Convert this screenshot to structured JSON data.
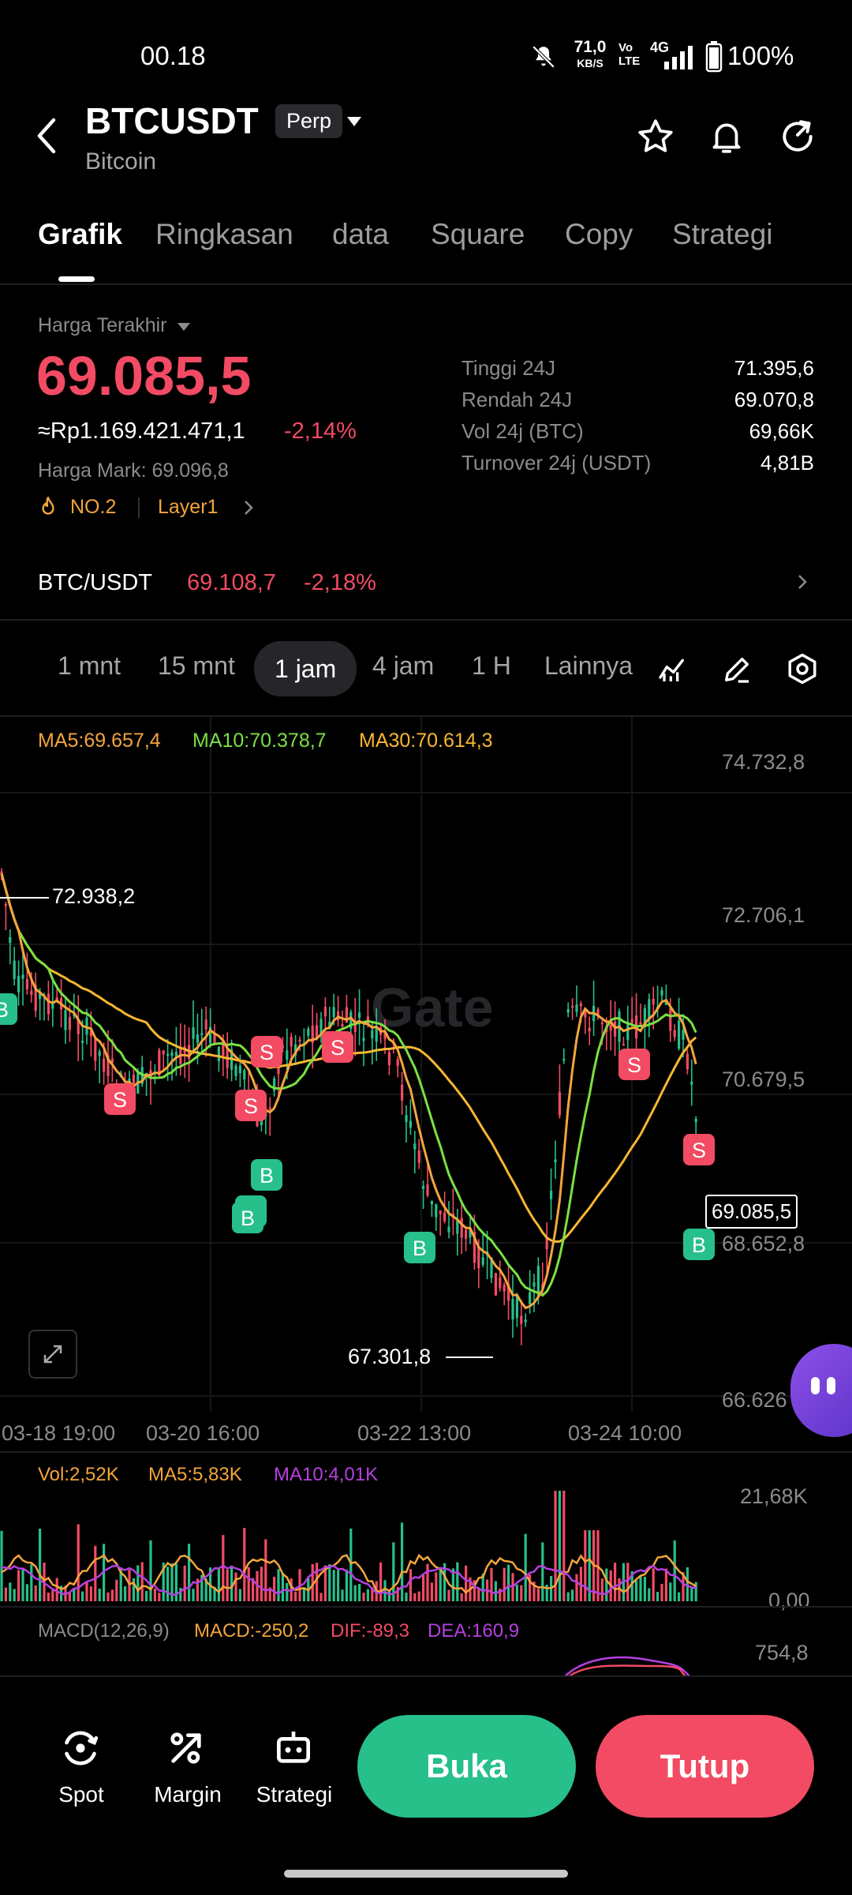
{
  "status_bar": {
    "time": "00.18",
    "net_speed": "71,0",
    "net_unit": "KB/S",
    "volte": "Vo LTE",
    "network": "4G",
    "battery": "100%"
  },
  "header": {
    "symbol": "BTCUSDT",
    "type_badge": "Perp",
    "name": "Bitcoin"
  },
  "tabs": [
    "Grafik",
    "Ringkasan",
    "data",
    "Square",
    "Copy",
    "Strategi"
  ],
  "price": {
    "label": "Harga Terakhir",
    "last": "69.085,5",
    "idr": "≈Rp1.169.421.471,1",
    "change": "-2,14%",
    "mark": "Harga Mark: 69.096,8",
    "rank": "NO.2",
    "tag": "Layer1"
  },
  "stats": [
    {
      "label": "Tinggi 24J",
      "value": "71.395,6"
    },
    {
      "label": "Rendah 24J",
      "value": "69.070,8"
    },
    {
      "label": "Vol 24j (BTC)",
      "value": "69,66K"
    },
    {
      "label": "Turnover 24j (USDT)",
      "value": "4,81B"
    }
  ],
  "spot": {
    "pair": "BTC/USDT",
    "price": "69.108,7",
    "change": "-2,18%"
  },
  "intervals": [
    "1 mnt",
    "15 mnt",
    "1 jam",
    "4 jam",
    "1 H",
    "Lainnya"
  ],
  "chart": {
    "ma5": "MA5:69.657,4",
    "ma10": "MA10:70.378,7",
    "ma30": "MA30:70.614,3",
    "price_axis": [
      "74.732,8",
      "72.706,1",
      "70.679,5",
      "68.652,8",
      "66.626"
    ],
    "high_marker": "72.938,2",
    "low_marker": "67.301,8",
    "current_price": "69.085,5",
    "time_axis": [
      "03-18 19:00",
      "03-20 16:00",
      "03-22 13:00",
      "03-24 10:00"
    ],
    "watermark": "Gate",
    "vol": "Vol:2,52K",
    "vol_ma5": "MA5:5,83K",
    "vol_ma10": "MA10:4,01K",
    "vol_axis": [
      "21,68K",
      "0,00"
    ],
    "macd": "MACD(12,26,9)",
    "macd_val": "MACD:-250,2",
    "dif": "DIF:-89,3",
    "dea": "DEA:160,9",
    "macd_axis": "754,8",
    "colors": {
      "up": "#27c08a",
      "down": "#f24b63",
      "ma5": "#f3a53c",
      "ma10": "#7be043",
      "ma30": "#f7b731",
      "vol_ma10": "#b540e0"
    }
  },
  "bottom": {
    "spot": "Spot",
    "margin": "Margin",
    "strategy": "Strategi",
    "open": "Buka",
    "close": "Tutup"
  }
}
